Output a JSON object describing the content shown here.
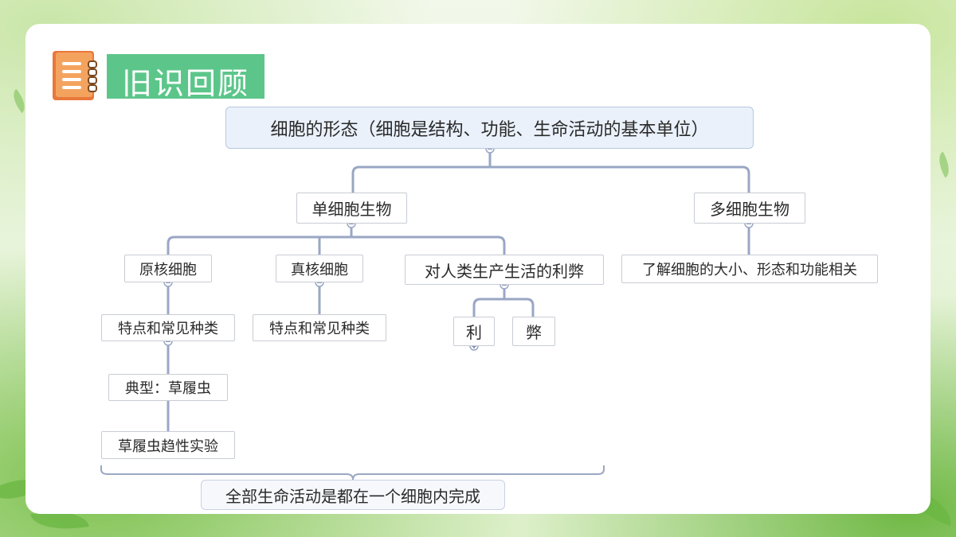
{
  "header": {
    "title": "旧识回顾"
  },
  "diagram": {
    "root": "细胞的形态（细胞是结构、功能、生命活动的基本单位）",
    "unicellular": "单细胞生物",
    "multicellular": "多细胞生物",
    "prokaryote": "原核细胞",
    "eukaryote": "真核细胞",
    "pros_cons": "对人类生产生活的利弊",
    "multi_desc": "了解细胞的大小、形态和功能相关",
    "prok_features": "特点和常见种类",
    "euk_features": "特点和常见种类",
    "pro": "利",
    "con": "弊",
    "typical": "典型：草履虫",
    "experiment": "草履虫趋性实验",
    "summary": "全部生命活动是都在一个细胞内完成"
  },
  "colors": {
    "title_bg": "#5cc68a",
    "connector": "#9aa7c4",
    "root_bg": "#eaf1fb"
  }
}
